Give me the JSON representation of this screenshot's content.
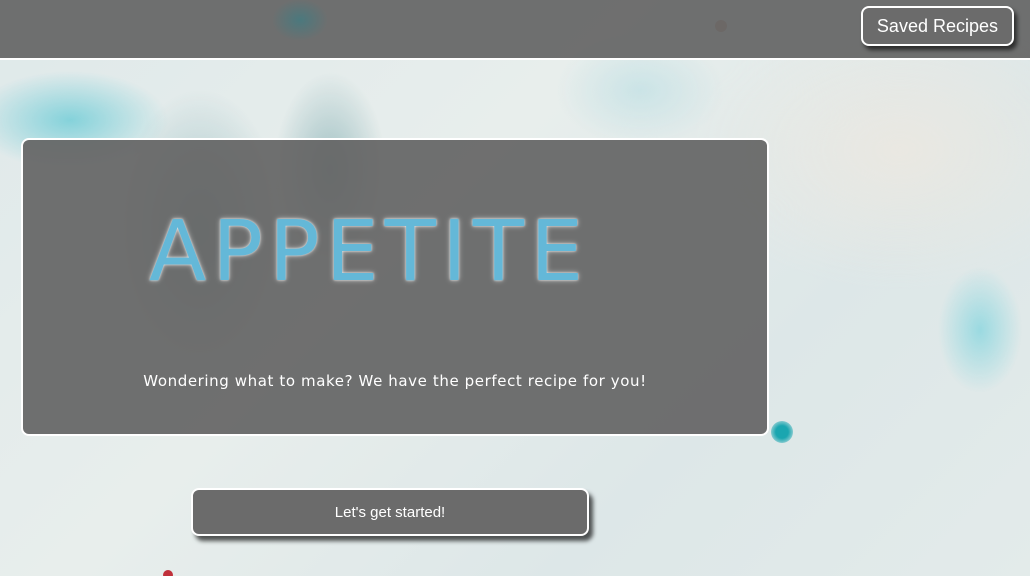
{
  "header": {
    "saved_recipes_label": "Saved Recipes"
  },
  "hero": {
    "title": "APPETITE",
    "subtitle": "Wondering what to make? We have the perfect recipe for you!"
  },
  "cta": {
    "start_label": "Let's get started!"
  },
  "colors": {
    "title_accent": "#64b8d8",
    "panel_bg": "#646464",
    "button_bg": "#6b6b6b",
    "border": "#ffffff"
  }
}
